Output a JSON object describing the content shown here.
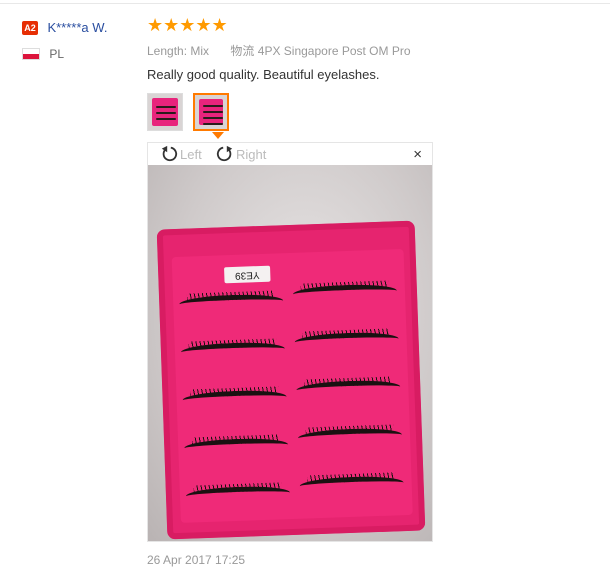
{
  "user": {
    "badge": "A2",
    "name": "K*****a W.",
    "country_code": "PL"
  },
  "review": {
    "stars": "★★★★★",
    "length_label": "Length:",
    "length_value": "Mix",
    "shipping_label": "物流",
    "shipping_value": "4PX Singapore Post OM Pro",
    "text": "Really good quality. Beautiful eyelashes.",
    "date": "26 Apr 2017 17:25"
  },
  "viewer": {
    "rotate_left": "Left",
    "rotate_right": "Right",
    "close": "×",
    "sticker": "YE39"
  },
  "colors": {
    "accent": "#ff7a00",
    "star": "#ff9a00",
    "badge": "#e62e04",
    "link": "#2a4ea0",
    "case": "#e6246f"
  }
}
